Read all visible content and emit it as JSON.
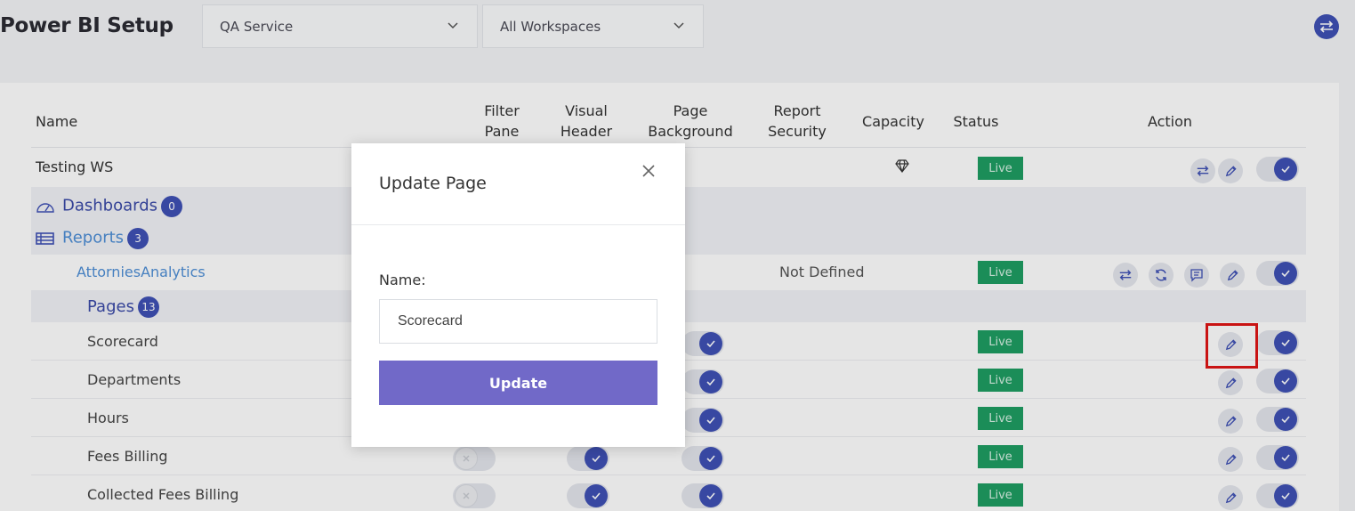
{
  "app": {
    "title": "Power BI Setup"
  },
  "filters": {
    "service": "QA Service",
    "workspace": "All Workspaces"
  },
  "table": {
    "headers": {
      "name": "Name",
      "filter_pane": "Filter Pane",
      "visual_header": "Visual Header",
      "page_background": "Page Background",
      "report_security": "Report Security",
      "capacity": "Capacity",
      "status": "Status",
      "action": "Action"
    },
    "workspace": {
      "name": "Testing WS",
      "status": "Live"
    },
    "dashboards": {
      "label": "Dashboards",
      "count": "0"
    },
    "reports": {
      "label": "Reports",
      "count": "3"
    },
    "report": {
      "name": "AttorniesAnalytics",
      "security": "Not Defined",
      "status": "Live"
    },
    "pages": {
      "label": "Pages",
      "count": "13",
      "rows": [
        {
          "name": "Scorecard",
          "status": "Live"
        },
        {
          "name": "Departments",
          "status": "Live"
        },
        {
          "name": "Hours",
          "status": "Live"
        },
        {
          "name": "Fees Billing",
          "status": "Live"
        },
        {
          "name": "Collected Fees Billing",
          "status": "Live"
        }
      ]
    }
  },
  "modal": {
    "title": "Update Page",
    "name_label": "Name:",
    "name_value": "Scorecard",
    "update_label": "Update"
  },
  "colors": {
    "accent": "#3f51b5",
    "live": "#1f9d63",
    "button": "#7169c8",
    "highlight": "#e01616"
  }
}
